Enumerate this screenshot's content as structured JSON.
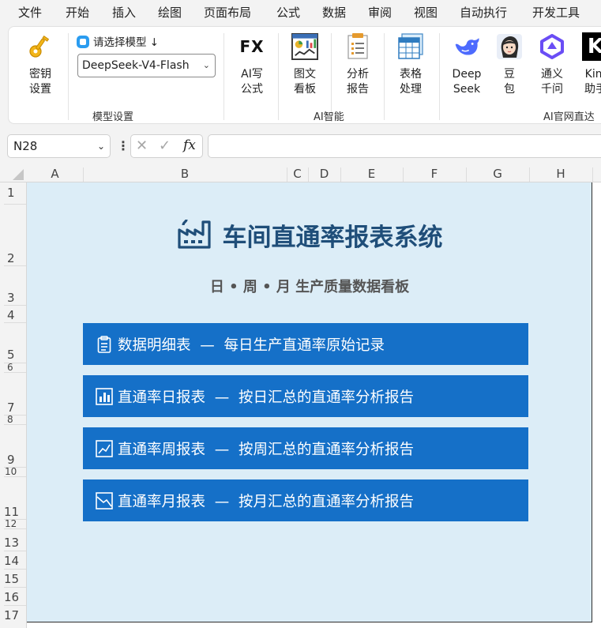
{
  "menu": [
    "文件",
    "开始",
    "插入",
    "绘图",
    "页面布局",
    "公式",
    "数据",
    "审阅",
    "视图",
    "自动执行",
    "开发工具"
  ],
  "ribbon": {
    "key_button": [
      "密钥",
      "设置"
    ],
    "model_select_label": "请选择模型",
    "model_select_arrow": "↓",
    "model_value": "DeepSeek-V4-Flash",
    "group_model": "模型设置",
    "ai_buttons": [
      {
        "icon": "fx",
        "icon_text": "FX",
        "label": [
          "AI写",
          "公式"
        ]
      },
      {
        "icon": "dashboard",
        "label": [
          "图文",
          "看板"
        ]
      },
      {
        "icon": "report",
        "label": [
          "分析",
          "报告"
        ]
      },
      {
        "icon": "table",
        "label": [
          "表格",
          "处理"
        ]
      }
    ],
    "group_ai": "AI智能",
    "web_buttons": [
      {
        "icon": "deepseek-whale",
        "label": [
          "Deep",
          "Seek"
        ]
      },
      {
        "icon": "doubao-avatar",
        "label": [
          "豆",
          "包"
        ]
      },
      {
        "icon": "tongyi-logo",
        "label": [
          "通义",
          "千问"
        ]
      },
      {
        "icon": "kimi-logo",
        "icon_text": "K",
        "label": [
          "Kim",
          "助手"
        ]
      }
    ],
    "group_web": "AI官网直达"
  },
  "formula_bar": {
    "name_box": "N28",
    "formula": ""
  },
  "columns": [
    "A",
    "B",
    "C",
    "D",
    "E",
    "F",
    "G",
    "H"
  ],
  "rows": [
    "1",
    "2",
    "3",
    "4",
    "5",
    "6",
    "7",
    "8",
    "9",
    "10",
    "11",
    "12",
    "13",
    "14",
    "15",
    "16",
    "17"
  ],
  "sheet": {
    "title": "车间直通率报表系统",
    "subtitle": "日 • 周 • 月 生产质量数据看板",
    "buttons": [
      {
        "icon": "clipboard-icon",
        "name": "数据明细表",
        "sep": "—",
        "desc": "每日生产直通率原始记录"
      },
      {
        "icon": "bar-chart-icon",
        "name": "直通率日报表",
        "sep": "—",
        "desc": "按日汇总的直通率分析报告"
      },
      {
        "icon": "line-chart-icon",
        "name": "直通率周报表",
        "sep": "—",
        "desc": "按周汇总的直通率分析报告"
      },
      {
        "icon": "area-chart-icon",
        "name": "直通率月报表",
        "sep": "—",
        "desc": "按月汇总的直通率分析报告"
      }
    ]
  },
  "colors": {
    "panel_bg": "#dcedf7",
    "title": "#1f4e79",
    "button": "#1570c8"
  }
}
